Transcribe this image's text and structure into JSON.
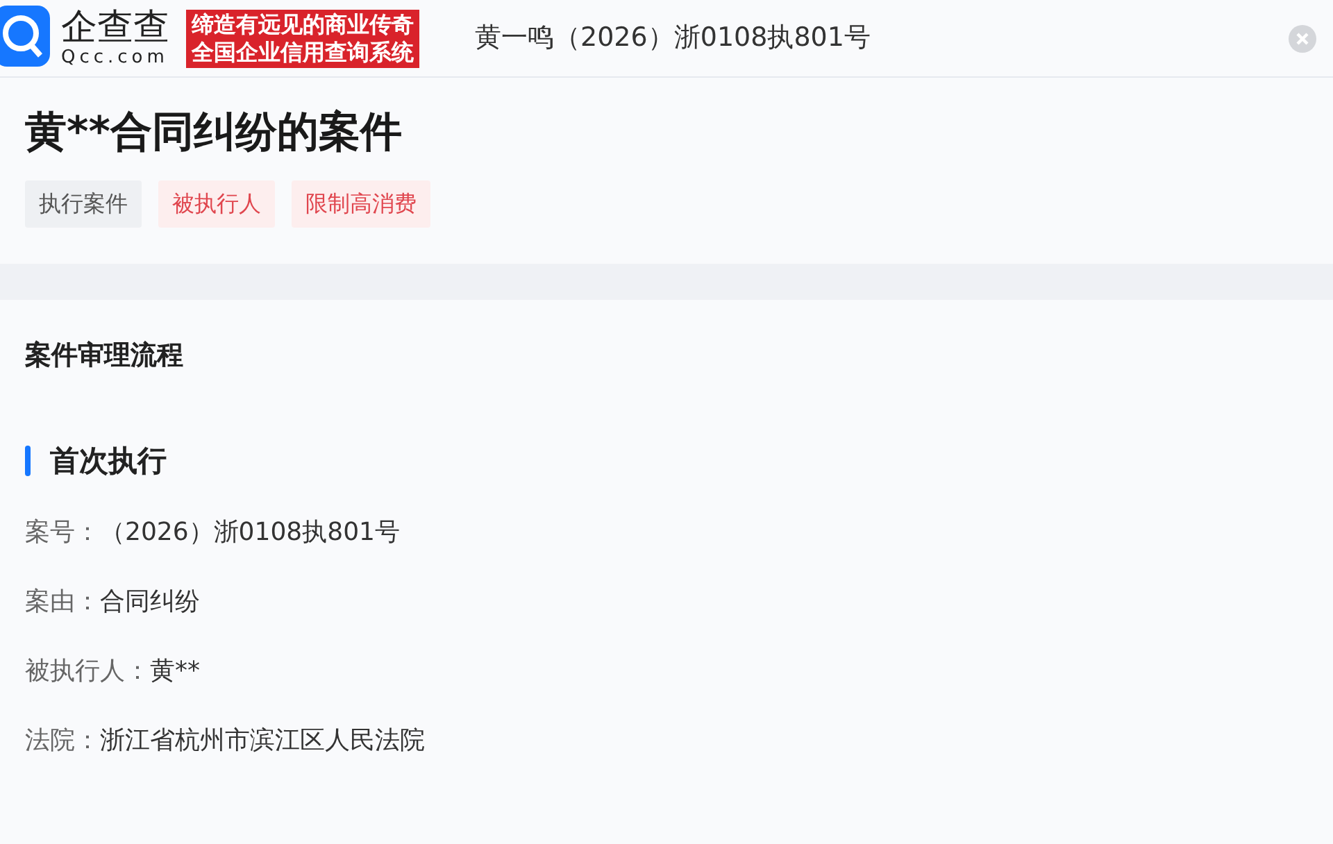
{
  "header": {
    "logo_text": "企查查",
    "logo_domain": "Qcc.com",
    "slogan_lines": [
      "缔造有远见的商业传奇",
      "全国企业信用查询系统"
    ],
    "search": {
      "value": "黄一鸣（2026）浙0108执801号"
    }
  },
  "case": {
    "title": "黄**合同纠纷的案件",
    "tags": [
      {
        "label": "执行案件",
        "kind": "neutral"
      },
      {
        "label": "被执行人",
        "kind": "danger"
      },
      {
        "label": "限制高消费",
        "kind": "danger"
      }
    ]
  },
  "process": {
    "title": "案件审理流程",
    "stage": "首次执行",
    "fields": [
      {
        "label": "案号：",
        "value": "（2026）浙0108执801号"
      },
      {
        "label": "案由：",
        "value": "合同纠纷"
      },
      {
        "label": "被执行人：",
        "value": "黄**"
      },
      {
        "label": "法院：",
        "value": "浙江省杭州市滨江区人民法院"
      }
    ]
  }
}
